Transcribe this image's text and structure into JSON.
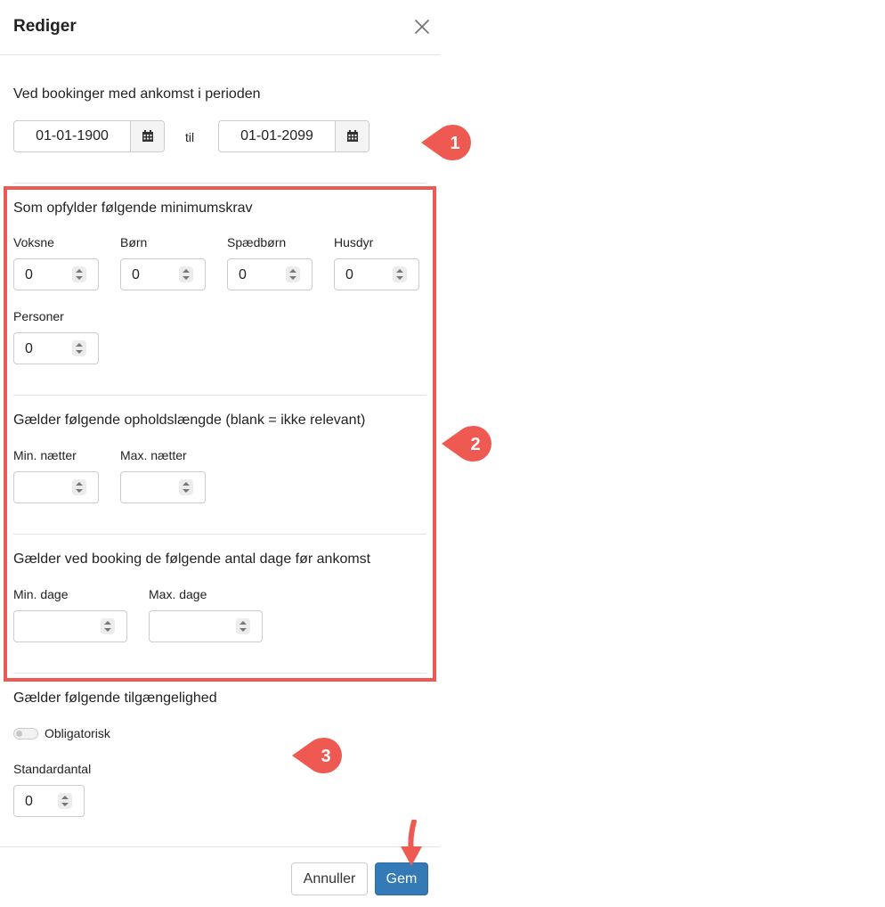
{
  "modal": {
    "title": "Rediger"
  },
  "period": {
    "heading": "Ved bookinger med ankomst i perioden",
    "from": "01-01-1900",
    "to_label": "til",
    "to": "01-01-2099"
  },
  "requirements": {
    "heading": "Som opfylder følgende minimumskrav",
    "fields": [
      {
        "label": "Voksne",
        "value": "0"
      },
      {
        "label": "Børn",
        "value": "0"
      },
      {
        "label": "Spædbørn",
        "value": "0"
      },
      {
        "label": "Husdyr",
        "value": "0"
      },
      {
        "label": "Personer",
        "value": "0"
      }
    ]
  },
  "stay_length": {
    "heading": "Gælder følgende opholdslængde (blank = ikke relevant)",
    "min_label": "Min. nætter",
    "min_value": "",
    "max_label": "Max. nætter",
    "max_value": ""
  },
  "days_before": {
    "heading": "Gælder ved booking de følgende antal dage før ankomst",
    "min_label": "Min. dage",
    "min_value": "",
    "max_label": "Max. dage",
    "max_value": ""
  },
  "availability": {
    "heading": "Gælder følgende tilgængelighed",
    "mandatory_label": "Obligatorisk",
    "mandatory_on": false,
    "default_label": "Standardantal",
    "default_value": "0"
  },
  "buttons": {
    "cancel": "Annuller",
    "save": "Gem"
  },
  "callouts": [
    "1",
    "2",
    "3"
  ],
  "colors": {
    "callout": "#ee5a52",
    "primary": "#337ab7"
  }
}
